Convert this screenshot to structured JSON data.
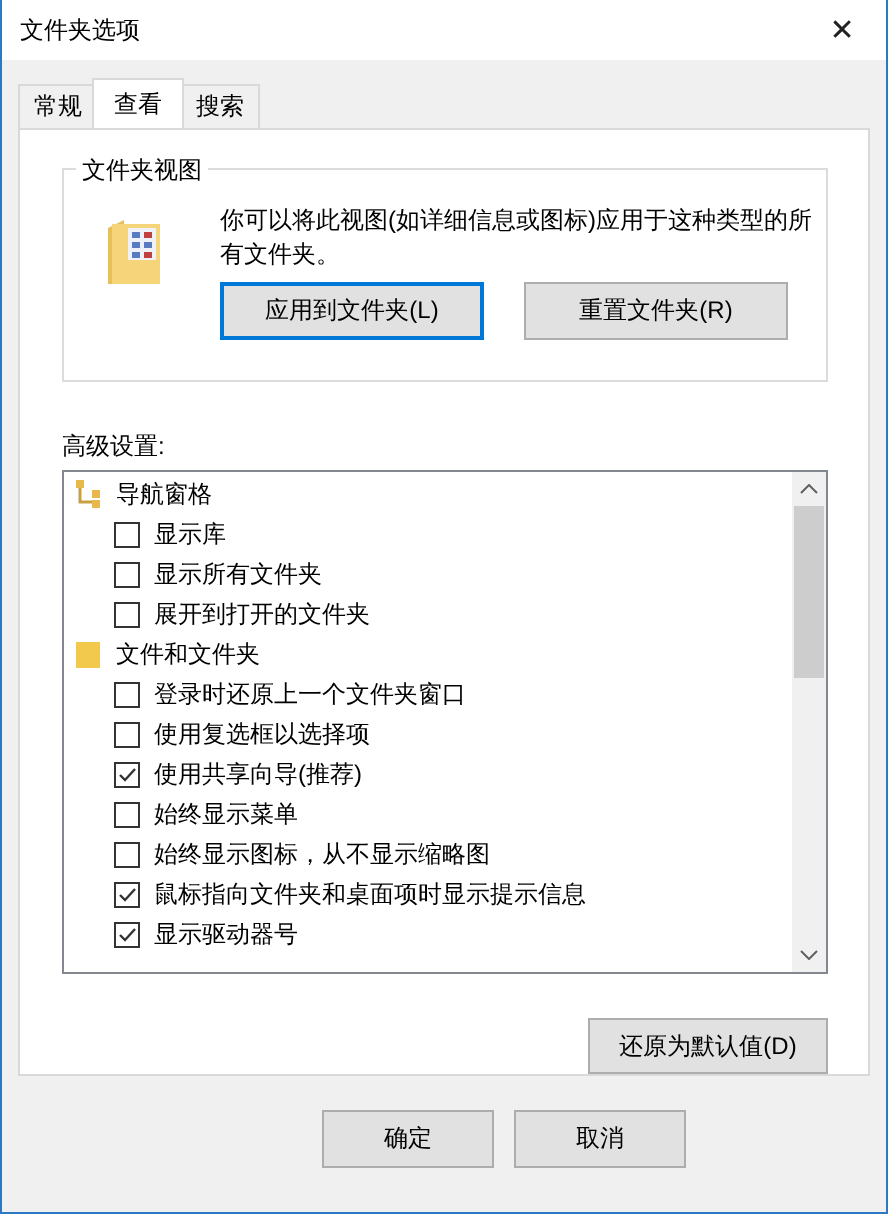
{
  "window": {
    "title": "文件夹选项",
    "close": "✕"
  },
  "tabs": [
    {
      "label": "常规",
      "selected": false
    },
    {
      "label": "查看",
      "selected": true
    },
    {
      "label": "搜索",
      "selected": false
    }
  ],
  "folder_views": {
    "title": "文件夹视图",
    "description": "你可以将此视图(如详细信息或图标)应用于这种类型的所有文件夹。",
    "buttons": [
      {
        "label": "应用到文件夹(L)",
        "focused": true
      },
      {
        "label": "重置文件夹(R)",
        "focused": false
      }
    ]
  },
  "advanced": {
    "label": "高级设置:",
    "items": [
      {
        "kind": "group",
        "label": "导航窗格"
      },
      {
        "kind": "checkbox",
        "label": "显示库",
        "checked": false
      },
      {
        "kind": "checkbox",
        "label": "显示所有文件夹",
        "checked": false
      },
      {
        "kind": "checkbox",
        "label": "展开到打开的文件夹",
        "checked": false
      },
      {
        "kind": "group",
        "label": "文件和文件夹"
      },
      {
        "kind": "checkbox",
        "label": "登录时还原上一个文件夹窗口",
        "checked": false
      },
      {
        "kind": "checkbox",
        "label": "使用复选框以选择项",
        "checked": false
      },
      {
        "kind": "checkbox",
        "label": "使用共享向导(推荐)",
        "checked": true
      },
      {
        "kind": "checkbox",
        "label": "始终显示菜单",
        "checked": false
      },
      {
        "kind": "checkbox",
        "label": "始终显示图标，从不显示缩略图",
        "checked": false
      },
      {
        "kind": "checkbox",
        "label": "鼠标指向文件夹和桌面项时显示提示信息",
        "checked": true
      },
      {
        "kind": "checkbox",
        "label": "显示驱动器号",
        "checked": true
      }
    ],
    "restore_button": "还原为默认值(D)"
  },
  "buttons": [
    "确定",
    "取消"
  ]
}
